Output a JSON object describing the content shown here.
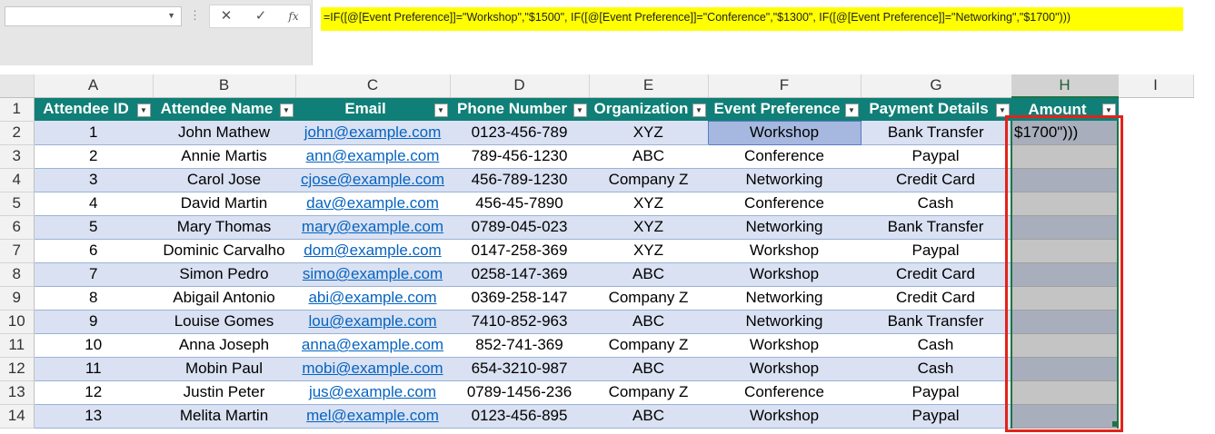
{
  "formula_bar": {
    "name_box": "",
    "cancel_icon": "✕",
    "enter_icon": "✓",
    "fx_label": "fx",
    "formula": "=IF([@[Event Preference]]=\"Workshop\",\"$1500\", IF([@[Event Preference]]=\"Conference\",\"$1300\", IF([@[Event Preference]]=\"Networking\",\"$1700\")))"
  },
  "columns": [
    "A",
    "B",
    "C",
    "D",
    "E",
    "F",
    "G",
    "H",
    "I"
  ],
  "rows": [
    "1",
    "2",
    "3",
    "4",
    "5",
    "6",
    "7",
    "8",
    "9",
    "10",
    "11",
    "12",
    "13",
    "14"
  ],
  "table": {
    "headers": [
      "Attendee ID",
      "Attendee Name",
      "Email",
      "Phone Number",
      "Organization",
      "Event Preference",
      "Payment Details",
      "Amount"
    ],
    "data": [
      [
        "1",
        "John Mathew",
        "john@example.com",
        "0123-456-789",
        "XYZ",
        "Workshop",
        "Bank Transfer",
        "$1700\")))"
      ],
      [
        "2",
        "Annie Martis",
        "ann@example.com",
        "789-456-1230",
        "ABC",
        "Conference",
        "Paypal",
        ""
      ],
      [
        "3",
        "Carol Jose",
        "cjose@example.com",
        "456-789-1230",
        "Company Z",
        "Networking",
        "Credit Card",
        ""
      ],
      [
        "4",
        "David Martin",
        "dav@example.com",
        "456-45-7890",
        "XYZ",
        "Conference",
        "Cash",
        ""
      ],
      [
        "5",
        "Mary Thomas",
        "mary@example.com",
        "0789-045-023",
        "XYZ",
        "Networking",
        "Bank Transfer",
        ""
      ],
      [
        "6",
        "Dominic  Carvalho",
        "dom@example.com",
        "0147-258-369",
        "XYZ",
        "Workshop",
        "Paypal",
        ""
      ],
      [
        "7",
        "Simon Pedro",
        "simo@example.com",
        "0258-147-369",
        "ABC",
        "Workshop",
        "Credit Card",
        ""
      ],
      [
        "8",
        "Abigail Antonio",
        "abi@example.com",
        "0369-258-147",
        "Company Z",
        "Networking",
        "Credit Card",
        ""
      ],
      [
        "9",
        "Louise Gomes",
        "lou@example.com",
        "7410-852-963",
        "ABC",
        "Networking",
        "Bank Transfer",
        ""
      ],
      [
        "10",
        "Anna Joseph",
        "anna@example.com",
        "852-741-369",
        "Company Z",
        "Workshop",
        "Cash",
        ""
      ],
      [
        "11",
        "Mobin Paul",
        "mobi@example.com",
        "654-3210-987",
        "ABC",
        "Workshop",
        "Cash",
        ""
      ],
      [
        "12",
        "Justin Peter",
        "jus@example.com",
        "0789-1456-236",
        "Company Z",
        "Conference",
        "Paypal",
        ""
      ],
      [
        "13",
        "Melita Martin",
        "mel@example.com",
        "0123-456-895",
        "ABC",
        "Workshop",
        "Paypal",
        ""
      ]
    ]
  },
  "colors": {
    "header_bg": "#0f7f77",
    "band_bg": "#d9e1f2",
    "highlight": "#ffff00",
    "annotation": "#e2231a",
    "link": "#0563c1"
  }
}
